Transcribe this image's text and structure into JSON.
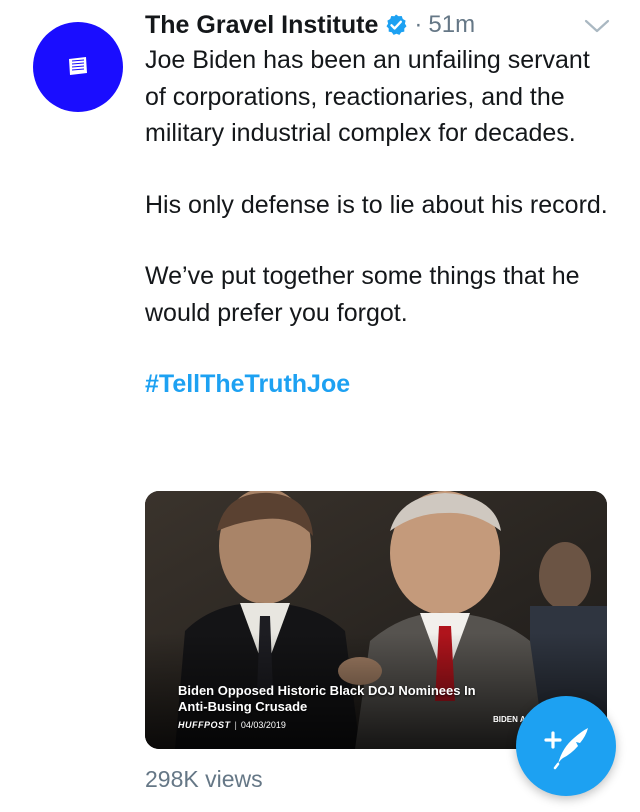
{
  "author": {
    "display_name": "The Gravel Institute",
    "verified": true
  },
  "meta": {
    "separator": "·",
    "timestamp": "51m"
  },
  "tweet": {
    "paragraphs": [
      "Joe Biden has been an unfailing servant of corporations, reactionaries, and the military industrial complex for decades.",
      "His only defense is to lie about his record.",
      "We’ve put together some things that he would prefer you forgot."
    ],
    "hashtag": "#TellTheTruthJoe"
  },
  "media": {
    "headline": "Biden Opposed Historic Black DOJ Nominees In Anti-Busing Crusade",
    "source": "HUFFPOST",
    "separator": "|",
    "date": "04/03/2019",
    "corner_caption": "BIDEN A"
  },
  "stats": {
    "views": "298K views"
  },
  "icons": {
    "verified": "verified-badge-icon",
    "menu": "chevron-down-icon",
    "compose": "compose-tweet-icon"
  },
  "colors": {
    "avatar_bg": "#1a0dff",
    "accent": "#1da1f2",
    "secondary_text": "#657786"
  }
}
